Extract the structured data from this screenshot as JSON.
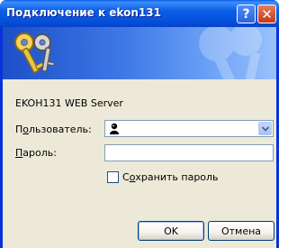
{
  "window": {
    "title": "Подключение к ekon131",
    "help_glyph": "?",
    "close_glyph": "✕"
  },
  "banner": {
    "left_icon": "keys-icon",
    "right_icon": "keys-watermark-icon"
  },
  "server_text": "EKOH131 WEB Server",
  "fields": {
    "user_label_pre": "П",
    "user_label_ul": "о",
    "user_label_post": "льзователь:",
    "user_value": "",
    "pass_label_ul": "П",
    "pass_label_post": "ароль:",
    "pass_value": ""
  },
  "save": {
    "label_pre": "С",
    "label_ul": "о",
    "label_post": "хранить пароль",
    "checked": false
  },
  "buttons": {
    "ok": "OK",
    "cancel": "Отмена"
  },
  "colors": {
    "titlebar": "#0554e0",
    "client": "#ece9d8",
    "close": "#c2381c"
  }
}
